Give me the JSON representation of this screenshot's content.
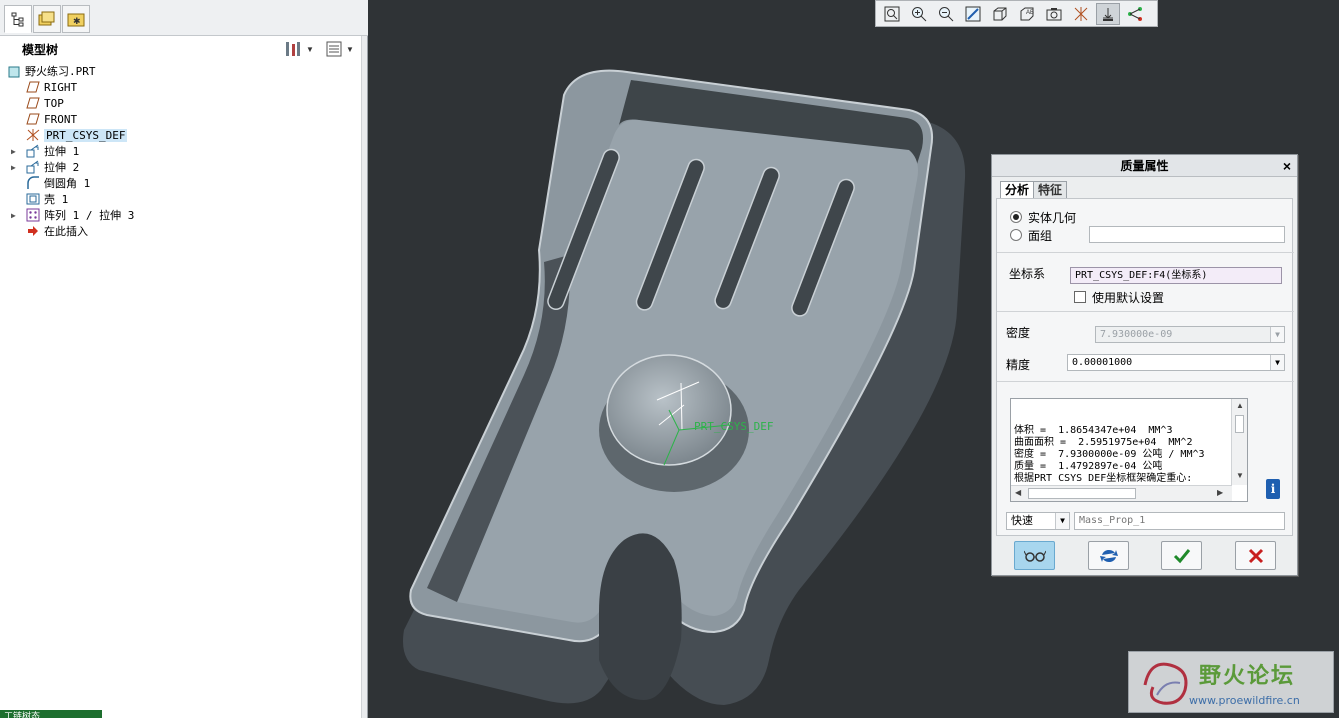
{
  "model_tree": {
    "title": "模型树",
    "items": [
      {
        "label": "野火练习.PRT",
        "icon": "part-icon",
        "expandable": false
      },
      {
        "label": "RIGHT",
        "icon": "datum-plane-icon",
        "expandable": false
      },
      {
        "label": "TOP",
        "icon": "datum-plane-icon",
        "expandable": false
      },
      {
        "label": "FRONT",
        "icon": "datum-plane-icon",
        "expandable": false
      },
      {
        "label": "PRT_CSYS_DEF",
        "icon": "csys-icon",
        "expandable": false,
        "selected": true
      },
      {
        "label": "拉伸 1",
        "icon": "extrude-icon",
        "expandable": true
      },
      {
        "label": "拉伸 2",
        "icon": "extrude-icon",
        "expandable": true
      },
      {
        "label": "倒圆角 1",
        "icon": "round-icon",
        "expandable": false
      },
      {
        "label": "壳 1",
        "icon": "shell-icon",
        "expandable": false
      },
      {
        "label": "阵列 1 / 拉伸 3",
        "icon": "pattern-icon",
        "expandable": true
      },
      {
        "label": "在此插入",
        "icon": "insert-here-icon",
        "expandable": false
      }
    ]
  },
  "status_tab_label": "工链树态",
  "toolbar": {
    "buttons": [
      "refit-icon",
      "zoom-in-icon",
      "zoom-out-icon",
      "repaint-icon",
      "view-orientation-icon",
      "named-views-icon",
      "display-style-icon",
      "datum-display-icon",
      "spin-center-icon",
      "annotation-display-icon"
    ]
  },
  "csys_label": "PRT_CSYS_DEF",
  "dialog": {
    "title": "质量属性",
    "close_symbol": "×",
    "tabs": [
      "分析",
      "特征"
    ],
    "radio_solid": "实体几何",
    "radio_quilt": "面组",
    "csys_label": "坐标系",
    "csys_value": "PRT_CSYS_DEF:F4(坐标系)",
    "use_default_label": "使用默认设置",
    "density_label": "密度",
    "density_value": "7.930000e-09",
    "precision_label": "精度",
    "precision_value": "0.00001000",
    "results": [
      "体积 =  1.8654347e+04  MM^3",
      "曲面面积 =  2.5951975e+04  MM^2",
      "密度 =  7.9300000e-09 公吨 / MM^3",
      "质量 =  1.4792897e-04 公吨",
      "",
      "根据PRT_CSYS_DEF坐标框架确定重心:"
    ],
    "mode_value": "快速",
    "name_placeholder": "Mass_Prop_1",
    "info_symbol": "i"
  },
  "watermark": {
    "title": "野火论坛",
    "url": "www.proewildfire.cn"
  },
  "colors": {
    "viewport_bg": "#2f3336",
    "part_face": "#98a3ab",
    "accent_green": "#5b9a3a"
  }
}
